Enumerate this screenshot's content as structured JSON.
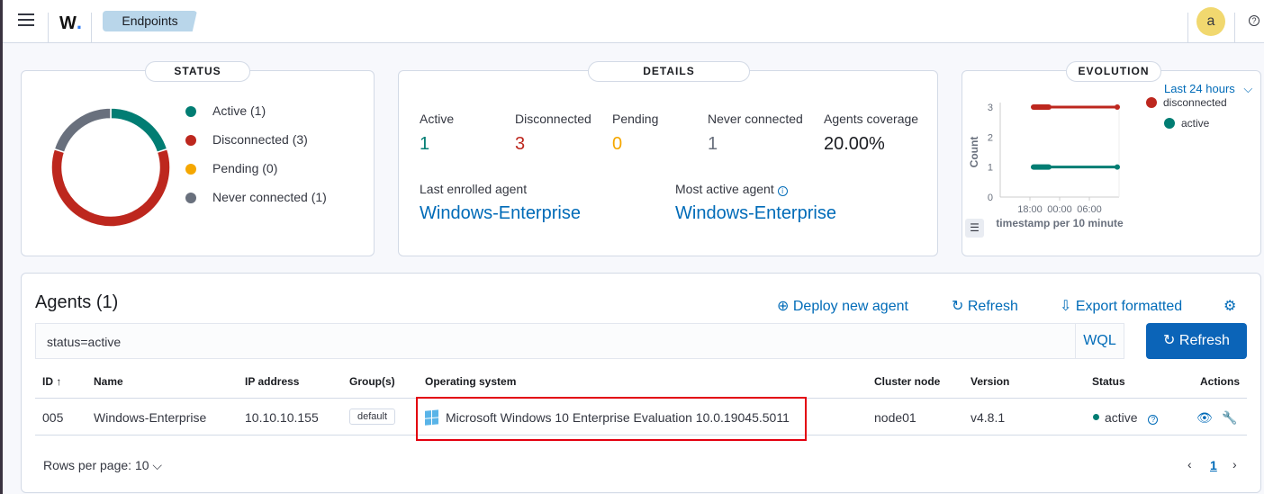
{
  "header": {
    "logo": "W",
    "breadcrumb": "Endpoints",
    "avatar": "a",
    "help_icon": "?"
  },
  "status": {
    "title": "STATUS",
    "legend": [
      {
        "label": "Active (1)",
        "color": "#017d73",
        "value": 1
      },
      {
        "label": "Disconnected (3)",
        "color": "#bd271e",
        "value": 3
      },
      {
        "label": "Pending (0)",
        "color": "#f5a700",
        "value": 0
      },
      {
        "label": "Never connected (1)",
        "color": "#69707d",
        "value": 1
      }
    ]
  },
  "details": {
    "title": "DETAILS",
    "stats": [
      {
        "label": "Active",
        "value": "1",
        "color": "#017d73"
      },
      {
        "label": "Disconnected",
        "value": "3",
        "color": "#bd271e"
      },
      {
        "label": "Pending",
        "value": "0",
        "color": "#f5a700"
      },
      {
        "label": "Never connected",
        "value": "1",
        "color": "#69707d"
      },
      {
        "label": "Agents coverage",
        "value": "20.00%",
        "color": "#1a1c21"
      }
    ],
    "last_enrolled_label": "Last enrolled agent",
    "last_enrolled": "Windows-Enterprise",
    "most_active_label": "Most active agent",
    "most_active": "Windows-Enterprise"
  },
  "evolution": {
    "title": "EVOLUTION",
    "range": "Last 24 hours",
    "chart_data": {
      "type": "line",
      "ylabel": "Count",
      "xlabel": "timestamp per 10 minute",
      "yticks": [
        "0",
        "1",
        "2",
        "3"
      ],
      "xticks": [
        "18:00",
        "00:00",
        "06:00"
      ],
      "ylim": [
        0,
        3
      ],
      "series": [
        {
          "name": "disconnected",
          "color": "#bd271e",
          "values": [
            3,
            3
          ]
        },
        {
          "name": "active",
          "color": "#017d73",
          "values": [
            1,
            1
          ]
        }
      ]
    }
  },
  "agents": {
    "title": "Agents (1)",
    "deploy": "Deploy new agent",
    "refresh": "Refresh",
    "export": "Export formatted",
    "search": "status=active",
    "wql": "WQL",
    "refresh_btn": "Refresh",
    "columns": [
      "ID ↑",
      "Name",
      "IP address",
      "Group(s)",
      "Operating system",
      "Cluster node",
      "Version",
      "Status",
      "Actions"
    ],
    "row": {
      "id": "005",
      "name": "Windows-Enterprise",
      "ip": "10.10.10.155",
      "group": "default",
      "os": "Microsoft Windows 10 Enterprise Evaluation 10.0.19045.5011",
      "node": "node01",
      "version": "v4.8.1",
      "status": "active"
    },
    "rows_per_page": "Rows per page: 10",
    "page": "1"
  }
}
